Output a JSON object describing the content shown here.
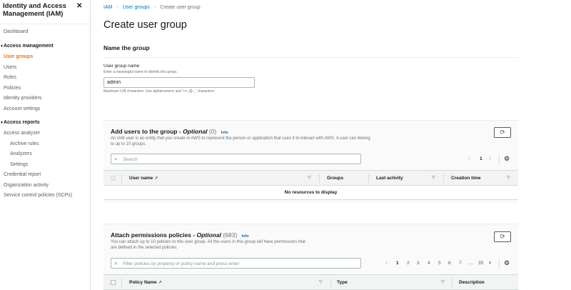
{
  "sidebar": {
    "title": "Identity and Access Management (IAM)",
    "dashboard": "Dashboard",
    "access_management": {
      "heading": "Access management",
      "items": [
        "User groups",
        "Users",
        "Roles",
        "Policies",
        "Identity providers",
        "Account settings"
      ],
      "active": "User groups"
    },
    "access_reports": {
      "heading": "Access reports",
      "items": [
        "Access analyzer",
        "Archive rules",
        "Analyzers",
        "Settings",
        "Credential report",
        "Organization activity",
        "Service control policies (SCPs)"
      ]
    }
  },
  "breadcrumb": [
    "IAM",
    "User groups",
    "Create user group"
  ],
  "page_title": "Create user group",
  "name_section": {
    "heading": "Name the group",
    "label": "User group name",
    "description": "Enter a meaningful name to identify this group.",
    "value": "admin",
    "constraint": "Maximum 128 characters. Use alphanumeric and '+=,.@-_' characters."
  },
  "users_panel": {
    "title": "Add users to the group - ",
    "optional": "Optional",
    "count": "(0)",
    "info": "Info",
    "description": "An IAM user is an entity that you create in AWS to represent the person or application that uses it to interact with AWS. A user can belong to up to 10 groups.",
    "search_placeholder": "Search",
    "page": "1",
    "columns": [
      "User name",
      "Groups",
      "Last activity",
      "Creation time"
    ],
    "empty": "No resources to display"
  },
  "policies_panel": {
    "title": "Attach permissions policies - ",
    "optional": "Optional",
    "count": "(683)",
    "info": "Info",
    "description": "You can attach up to 10 policies to this user group. All the users in this group will have permissions that are defined in the selected policies.",
    "search_placeholder": "Filter policies by property or policy name and press enter",
    "pages": [
      "1",
      "2",
      "3",
      "4",
      "5",
      "6",
      "7",
      "...",
      "35"
    ],
    "current_page": "1",
    "columns": [
      "Policy Name",
      "Type",
      "Description"
    ]
  },
  "colors": {
    "accent": "#ec7211",
    "link": "#0073bb"
  },
  "icons": [
    "close-icon",
    "external-link-icon",
    "refresh-icon",
    "search-icon",
    "gear-icon",
    "sort-caret-icon"
  ]
}
